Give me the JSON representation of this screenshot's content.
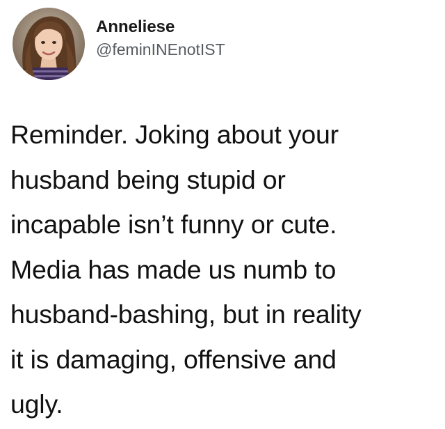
{
  "author": {
    "display_name": "Anneliese",
    "handle": "@feminINEnotIST",
    "avatar_icon": "profile-photo"
  },
  "tweet": {
    "lines": [
      "Reminder. Joking about your",
      "husband being stupid or",
      "incapable isn’t funny or cute.",
      "Media has made us numb to",
      "husband-bashing, but in reality",
      "it is damaging, offensive and",
      "ugly."
    ]
  },
  "colors": {
    "text": "#111111",
    "handle": "#555b61",
    "background": "#ffffff"
  }
}
